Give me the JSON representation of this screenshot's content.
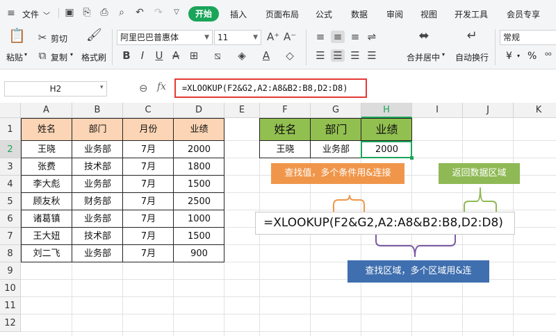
{
  "menubar": {
    "file_label": "文件",
    "tabs": [
      "开始",
      "插入",
      "页面布局",
      "公式",
      "数据",
      "审阅",
      "视图",
      "开发工具",
      "会员专享"
    ]
  },
  "ribbon": {
    "paste": "粘贴",
    "cut": "剪切",
    "copy": "复制",
    "format_painter": "格式刷",
    "font_name": "阿里巴巴普惠体",
    "font_size": "11",
    "merge_center": "合并居中",
    "wrap_text": "自动换行",
    "number_format": "常规",
    "currency_symbol": "¥",
    "percent_symbol": "%"
  },
  "formula_bar": {
    "name_box": "H2",
    "fx": "fx",
    "formula": "=XLOOKUP(F2&G2,A2:A8&B2:B8,D2:D8)"
  },
  "columns": [
    "A",
    "B",
    "C",
    "D",
    "E",
    "F",
    "G",
    "H",
    "I",
    "J",
    "K"
  ],
  "rows": [
    "1",
    "2",
    "3",
    "4",
    "5",
    "6",
    "7",
    "8",
    "9",
    "10",
    "11",
    "12"
  ],
  "table": {
    "headers": [
      "姓名",
      "部门",
      "月份",
      "业绩"
    ],
    "rows": [
      [
        "王晓",
        "业务部",
        "7月",
        "2000"
      ],
      [
        "张费",
        "技术部",
        "7月",
        "1800"
      ],
      [
        "李大彪",
        "业务部",
        "7月",
        "1500"
      ],
      [
        "顾友秋",
        "财务部",
        "7月",
        "2500"
      ],
      [
        "诸葛镇",
        "业务部",
        "7月",
        "1000"
      ],
      [
        "王大妞",
        "技术部",
        "7月",
        "1500"
      ],
      [
        "刘二飞",
        "业务部",
        "7月",
        "900"
      ]
    ]
  },
  "lookup": {
    "headers": [
      "姓名",
      "部门",
      "业绩"
    ],
    "row": [
      "王晓",
      "业务部",
      "2000"
    ]
  },
  "annotations": {
    "lookup_value": "查找值，多个条件用&连接",
    "return_range": "返回数据区域",
    "lookup_range": "查找区域，多个区域用&连",
    "formula": "=XLOOKUP(F2&G2,A2:A8&B2:B8,D2:D8)"
  },
  "colors": {
    "accent_green": "#1aa55a",
    "header_orange": "#fbd5b5",
    "header_green": "#92c050",
    "callout_orange": "#f0964a",
    "callout_green": "#8fb955",
    "callout_blue": "#3f6faf",
    "brace_purple": "#7b5aa6",
    "formula_highlight": "#e53935"
  }
}
